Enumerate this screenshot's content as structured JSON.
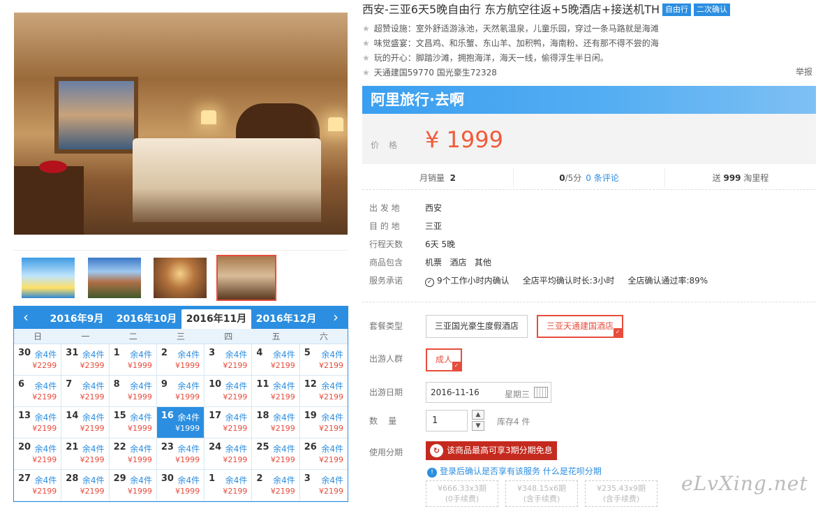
{
  "title": "西安-三亚6天5晚自由行 东方航空往返+5晚酒店+接送机TH",
  "tags": [
    "自由行",
    "二次确认"
  ],
  "features": [
    "超赞设施：室外舒适游泳池，天然氡温泉，儿童乐园，穿过一条马路就是海滩",
    "味觉盛宴：文昌鸡、和乐蟹、东山羊、加积鸭，海南粉、还有那不得不尝的海",
    "玩的开心：脚踏沙滩，拥抱海洋，海天一线，偷得浮生半日闲。",
    "天通建国59770 国光豪生72328"
  ],
  "report_label": "举报",
  "brand": "阿里旅行·去啊",
  "price": {
    "label": "价格",
    "value": "¥ 1999"
  },
  "stats": {
    "monthly_label": "月销量",
    "monthly": "2",
    "score": "0",
    "score_unit": "/5分",
    "reviews": "0 条评论",
    "points_prefix": "送",
    "points": "999",
    "points_suffix": "淘里程"
  },
  "info": [
    {
      "k": "出 发 地",
      "v": "西安"
    },
    {
      "k": "目 的 地",
      "v": "三亚"
    },
    {
      "k": "行程天数",
      "v": "6天 5晚"
    },
    {
      "k": "商品包含",
      "v": "机票   酒店   其他"
    },
    {
      "k": "服务承诺",
      "v": "9个工作小时内确认     全店平均确认时长:3小时     全店确认通过率:89%"
    }
  ],
  "package": {
    "label": "套餐类型",
    "options": [
      "三亚国光豪生度假酒店",
      "三亚天通建国酒店"
    ],
    "selected": "三亚天通建国酒店"
  },
  "travelers": {
    "label": "出游人群",
    "option": "成人"
  },
  "date": {
    "label": "出游日期",
    "value": "2016-11-16",
    "weekday": "星期三"
  },
  "quantity": {
    "label": "数    量",
    "value": "1",
    "stock": "库存4 件"
  },
  "installment": {
    "label": "使用分期",
    "banner": "该商品最高可享3期分期免息",
    "note": "登录后确认是否享有该服务",
    "link": "什么是花呗分期",
    "plans": [
      {
        "l1": "¥666.33x3期",
        "l2": "(0手续费)"
      },
      {
        "l1": "¥348.15x6期",
        "l2": "(含手续费)"
      },
      {
        "l1": "¥235.43x9期",
        "l2": "(含手续费)"
      }
    ]
  },
  "calendar": {
    "months": [
      "2016年9月",
      "2016年10月",
      "2016年11月",
      "2016年12月"
    ],
    "active_month": "2016年11月",
    "weekdays": [
      "日",
      "一",
      "二",
      "三",
      "四",
      "五",
      "六"
    ],
    "stock_label": "余4件",
    "days": [
      {
        "d": "30",
        "p": "¥2299"
      },
      {
        "d": "31",
        "p": "¥2399"
      },
      {
        "d": "1",
        "p": "¥1999"
      },
      {
        "d": "2",
        "p": "¥1999"
      },
      {
        "d": "3",
        "p": "¥2199"
      },
      {
        "d": "4",
        "p": "¥2199"
      },
      {
        "d": "5",
        "p": "¥2199"
      },
      {
        "d": "6",
        "p": "¥2199"
      },
      {
        "d": "7",
        "p": "¥2199"
      },
      {
        "d": "8",
        "p": "¥1999"
      },
      {
        "d": "9",
        "p": "¥1999"
      },
      {
        "d": "10",
        "p": "¥2199"
      },
      {
        "d": "11",
        "p": "¥2199"
      },
      {
        "d": "12",
        "p": "¥2199"
      },
      {
        "d": "13",
        "p": "¥2199"
      },
      {
        "d": "14",
        "p": "¥2199"
      },
      {
        "d": "15",
        "p": "¥1999"
      },
      {
        "d": "16",
        "p": "¥1999",
        "selected": true
      },
      {
        "d": "17",
        "p": "¥2199"
      },
      {
        "d": "18",
        "p": "¥2199"
      },
      {
        "d": "19",
        "p": "¥2199"
      },
      {
        "d": "20",
        "p": "¥2199"
      },
      {
        "d": "21",
        "p": "¥2199"
      },
      {
        "d": "22",
        "p": "¥1999"
      },
      {
        "d": "23",
        "p": "¥1999"
      },
      {
        "d": "24",
        "p": "¥2199"
      },
      {
        "d": "25",
        "p": "¥2199"
      },
      {
        "d": "26",
        "p": "¥2199"
      },
      {
        "d": "27",
        "p": "¥2199"
      },
      {
        "d": "28",
        "p": "¥2199"
      },
      {
        "d": "29",
        "p": "¥1999"
      },
      {
        "d": "30",
        "p": "¥1999"
      },
      {
        "d": "1",
        "p": "¥2199"
      },
      {
        "d": "2",
        "p": "¥2199"
      },
      {
        "d": "3",
        "p": "¥2199"
      }
    ]
  },
  "watermark": "eLvXing.net",
  "colors": {
    "accent": "#2b8ee0",
    "price": "#f05b3a",
    "selected_border": "#e74c3c",
    "huabei": "#c52a1f"
  }
}
